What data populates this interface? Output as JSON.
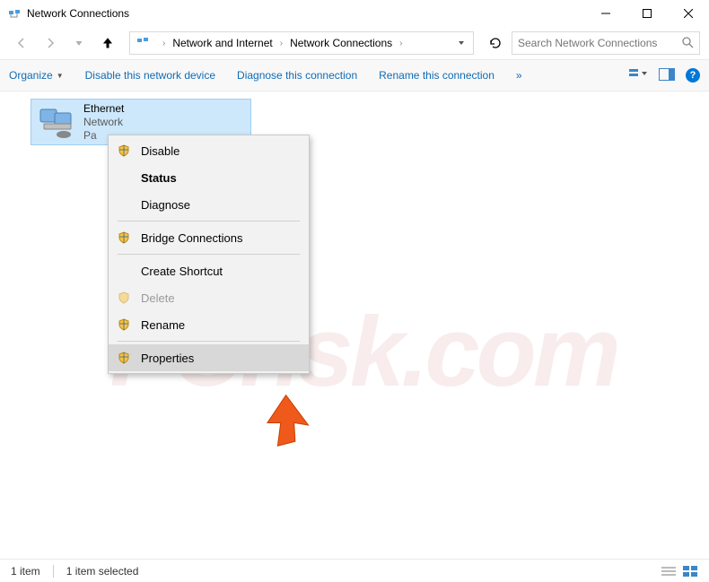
{
  "window": {
    "title": "Network Connections"
  },
  "breadcrumb": {
    "items": [
      "Network and Internet",
      "Network Connections"
    ]
  },
  "search": {
    "placeholder": "Search Network Connections"
  },
  "toolbar": {
    "organize": "Organize",
    "disable": "Disable this network device",
    "diagnose": "Diagnose this connection",
    "rename": "Rename this connection",
    "overflow": "»"
  },
  "adapter": {
    "name": "Ethernet",
    "sub1": "Network",
    "sub2": "Pa"
  },
  "context_menu": {
    "items": [
      {
        "label": "Disable",
        "shield": true,
        "bold": false,
        "disabled": false
      },
      {
        "label": "Status",
        "shield": false,
        "bold": true,
        "disabled": false
      },
      {
        "label": "Diagnose",
        "shield": false,
        "bold": false,
        "disabled": false
      }
    ],
    "items2": [
      {
        "label": "Bridge Connections",
        "shield": true,
        "bold": false,
        "disabled": false
      }
    ],
    "items3": [
      {
        "label": "Create Shortcut",
        "shield": false,
        "bold": false,
        "disabled": false
      },
      {
        "label": "Delete",
        "shield": true,
        "bold": false,
        "disabled": true
      },
      {
        "label": "Rename",
        "shield": true,
        "bold": false,
        "disabled": false
      }
    ],
    "items4": [
      {
        "label": "Properties",
        "shield": true,
        "bold": false,
        "disabled": false,
        "hover": true
      }
    ]
  },
  "status": {
    "count": "1 item",
    "selected": "1 item selected"
  },
  "watermark": "PCrisk.com"
}
